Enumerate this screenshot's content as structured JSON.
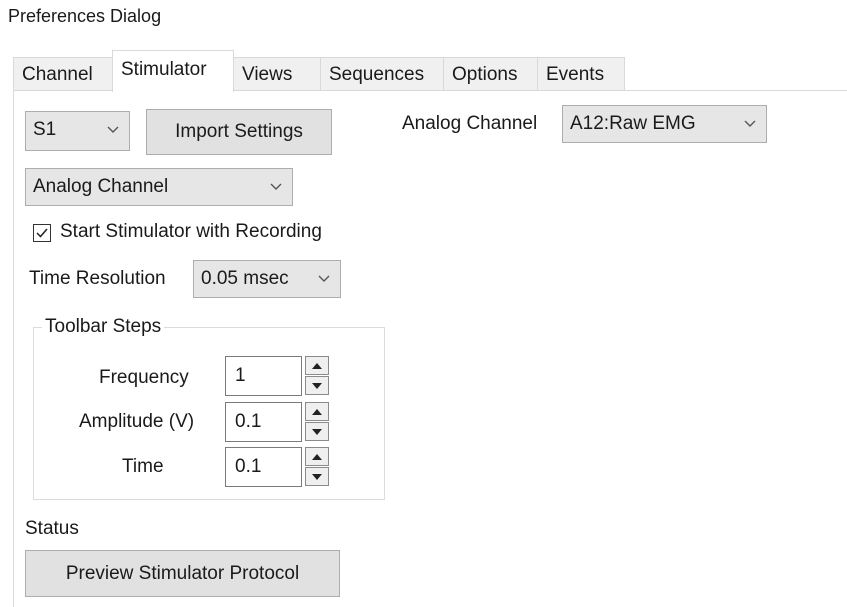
{
  "window": {
    "title": "Preferences Dialog"
  },
  "tabs": [
    {
      "label": "Channel",
      "active": false
    },
    {
      "label": "Stimulator",
      "active": true
    },
    {
      "label": "Views",
      "active": false
    },
    {
      "label": "Sequences",
      "active": false
    },
    {
      "label": "Options",
      "active": false
    },
    {
      "label": "Events",
      "active": false
    }
  ],
  "stimulator": {
    "stimulator_select": {
      "value": "S1"
    },
    "import_button_label": "Import Settings",
    "analog_channel_label": "Analog Channel",
    "analog_channel_select": {
      "value": "A12:Raw EMG"
    },
    "mode_select": {
      "value": "Analog Channel"
    },
    "start_with_recording": {
      "label": "Start Stimulator with Recording",
      "checked": true
    },
    "time_resolution": {
      "label": "Time Resolution",
      "value": "0.05 msec"
    },
    "toolbar_steps": {
      "legend": "Toolbar Steps",
      "fields": [
        {
          "label": "Frequency",
          "value": "1"
        },
        {
          "label": "Amplitude (V)",
          "value": "0.1"
        },
        {
          "label": "Time",
          "value": "0.1"
        }
      ]
    },
    "status_label": "Status",
    "preview_button_label": "Preview Stimulator Protocol"
  }
}
